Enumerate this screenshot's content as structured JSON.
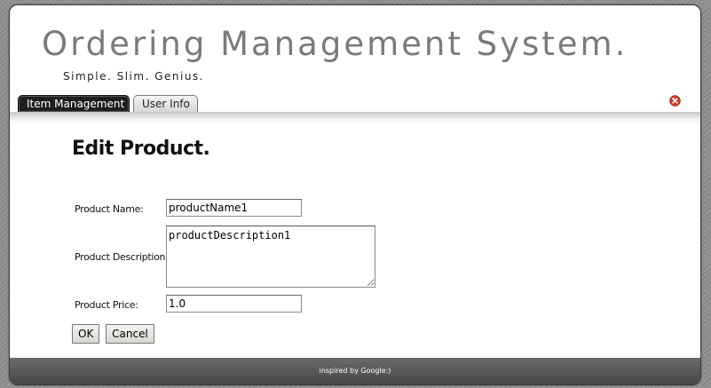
{
  "header": {
    "app_title": "Ordering Management System.",
    "tagline": "Simple. Slim. Genius."
  },
  "tabs": [
    {
      "label": "Item Management",
      "active": true
    },
    {
      "label": "User Info",
      "active": false
    }
  ],
  "form": {
    "title": "Edit Product.",
    "name_label": "Product Name:",
    "name_value": "productName1",
    "description_label": "Product Description:",
    "description_value": "productDescription1",
    "price_label": "Product Price:",
    "price_value": "1.0",
    "ok_label": "OK",
    "cancel_label": "Cancel"
  },
  "footer": {
    "text": "inspired by Google:)"
  },
  "icons": {
    "close": "close-icon"
  },
  "colors": {
    "active_tab": "#1f1f1f",
    "footer": "#555555",
    "close_icon": "#d23b2a"
  }
}
